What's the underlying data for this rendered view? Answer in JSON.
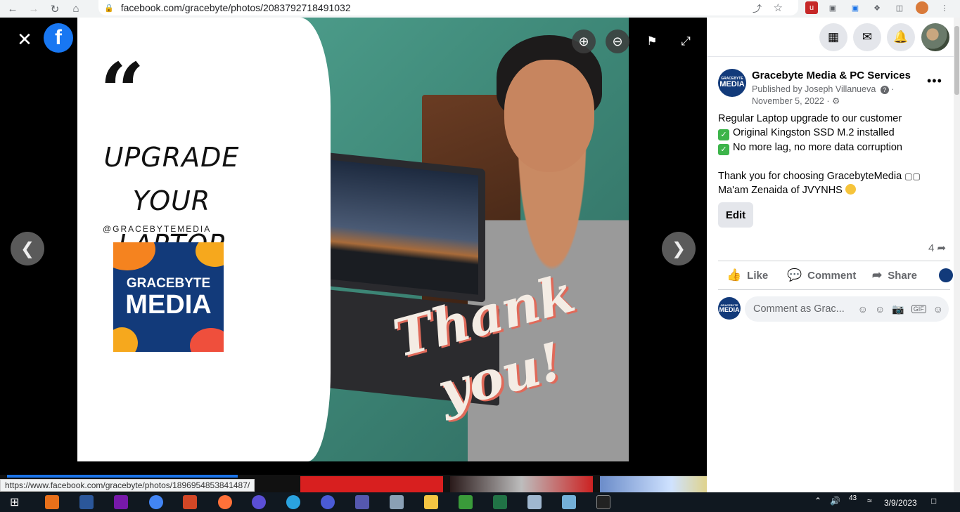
{
  "browser": {
    "url": "facebook.com/gracebyte/photos/2083792718491032",
    "status_url": "https://www.facebook.com/gracebyte/photos/1896954853841487/"
  },
  "photo": {
    "headline": "UPGRADE YOUR LAPTOP NOW!",
    "handle": "@GRACEBYTEMEDIA",
    "logo_line1": "GRACEBYTE",
    "logo_line2": "MEDIA",
    "thank_you": "Thank you!"
  },
  "viewer": {
    "prev_icon": "chevron-left-icon",
    "next_icon": "chevron-right-icon"
  },
  "post": {
    "page_name": "Gracebyte Media & PC Services",
    "published_by": "Published by Joseph Villanueva",
    "date": "November 5, 2022",
    "avatar_line1": "GRACEBYTE",
    "avatar_line2": "MEDIA",
    "body_line1": "Regular Laptop upgrade to our customer",
    "body_line2": "Original Kingston SSD M.2 installed",
    "body_line3": "No more lag, no more data corruption",
    "body_line4": "Thank you for choosing GracebyteMedia",
    "body_line5": "Ma'am Zenaida of JVYNHS",
    "edit_label": "Edit",
    "share_count": "4",
    "like_label": "Like",
    "comment_label": "Comment",
    "share_label": "Share",
    "comment_placeholder": "Comment as Grac..."
  },
  "taskbar": {
    "time": "3/9/2023",
    "temp": "43"
  },
  "colors": {
    "facebook_blue": "#1877f2",
    "brand_navy": "#123a7a"
  }
}
